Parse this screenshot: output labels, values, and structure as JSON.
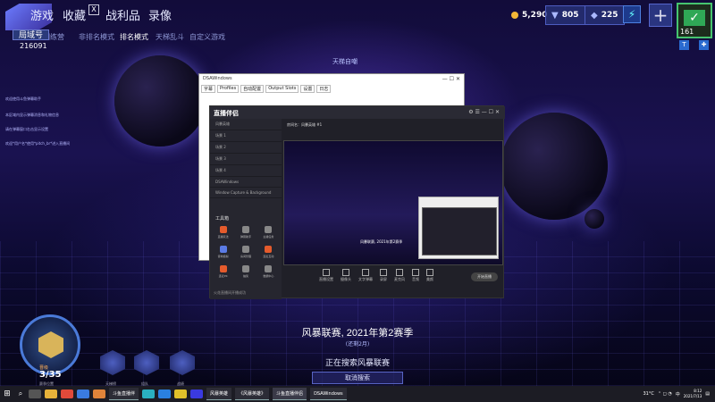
{
  "nav": {
    "logo": "G",
    "items": [
      "游戏",
      "收藏",
      "战利品",
      "录像"
    ],
    "collect_badge": "X",
    "currency": {
      "gold": "5,290",
      "gems": "805",
      "shards": "225"
    }
  },
  "profile": {
    "level": "161"
  },
  "sub_tabs": [
    "训练营",
    "非排名模式",
    "排名模式",
    "天梯乱斗",
    "自定义游戏"
  ],
  "player": {
    "tag": "局域号",
    "id": "216091"
  },
  "status_title": "天梯自嘲",
  "chat": [
    "欢迎使用斗鱼弹幕助手",
    "本区域内显示弹幕消息和礼物信息",
    "请在弹幕窗口右击显示设置",
    "欢迎*用户名*使用*pitch_br*进入直播间"
  ],
  "dsa_window": {
    "title": "DSAWindows",
    "tabs": [
      "字幕",
      "Profiles",
      "自动配置",
      "Output Slots",
      "设置",
      "日志"
    ]
  },
  "stream_app": {
    "name": "直播伴侣",
    "left_rows": [
      "风暴英雄",
      "场景 1",
      "场景 2",
      "场景 3",
      "场景 4",
      "DSAWindows",
      "Window Capture & Background",
      "工具箱"
    ],
    "toolbox_title": "工具箱",
    "tools": [
      "直播玩法",
      "弹幕助手",
      "主播任务",
      "音效模拟",
      "房间管理",
      "连麦互动",
      "连麦PK",
      "抽奖",
      "数据中心"
    ],
    "preview_title": "房间名：风暴英雄 #1",
    "preview_caption": "风暴联赛, 2021年第2赛季",
    "toolbar": [
      "直播设置",
      "摄像头",
      "文字弹幕",
      "录屏",
      "麦克风",
      "音频",
      "美颜"
    ],
    "start_button": "开始直播",
    "footer": "火花直播间开播成功"
  },
  "season": {
    "title": "风暴联赛, 2021年第2赛季",
    "sub": "(还剩2月)",
    "searching": "正在搜索风暴联赛",
    "cancel": "取消搜索"
  },
  "rank": {
    "label": "晋级",
    "count": "3/35",
    "sub": "赛季位置",
    "mini_labels": [
      "天梯榜",
      "组队",
      "战绩"
    ]
  },
  "taskbar": {
    "apps": [
      "斗鱼直播伴",
      "风暴英雄",
      "《风暴英雄》",
      "斗鱼直播伴侣",
      "DSAWindows"
    ],
    "temp": "31°C",
    "lang": "中",
    "time": "8:12",
    "date": "2021/7/13"
  }
}
